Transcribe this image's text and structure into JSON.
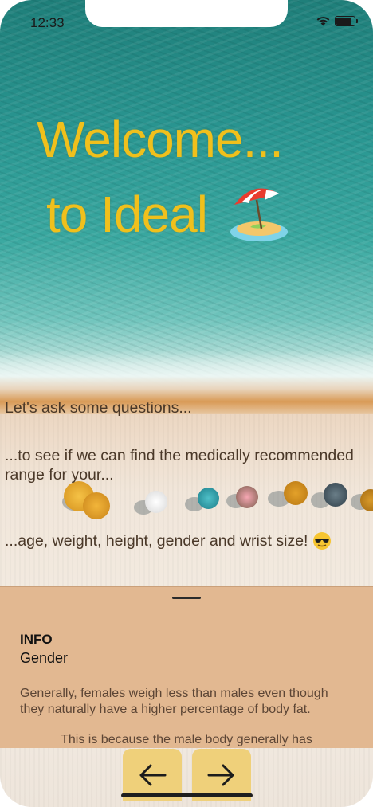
{
  "status_bar": {
    "time": "12:33"
  },
  "welcome": {
    "line1": "Welcome...",
    "line2": "to Ideal"
  },
  "intro": {
    "line1": "Let's ask some questions...",
    "line2": "...to see if we can find the medically recommended range for your...",
    "line3": "...age, weight, height, gender and wrist size!"
  },
  "sheet": {
    "title": "INFO",
    "subtitle": "Gender",
    "body1": "Generally, females weigh less than males even though they naturally have a higher percentage of body fat.",
    "body2": "This is because the male body generally has"
  },
  "icons": {
    "beach": "beach-umbrella-island-icon",
    "sunglasses": "sunglasses-emoji-icon",
    "back": "arrow-left-icon",
    "forward": "arrow-right-icon"
  },
  "colors": {
    "title": "#f0c01c",
    "sheet": "#e2b891",
    "nav_button": "#efd07a"
  }
}
